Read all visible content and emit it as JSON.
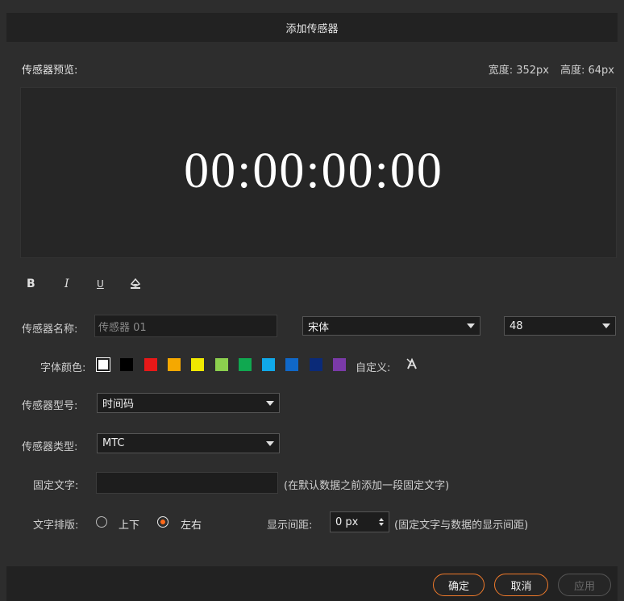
{
  "dialog": {
    "title": "添加传感器"
  },
  "preview": {
    "label": "传感器预览:",
    "width_text": "宽度: 352px",
    "height_text": "高度: 64px",
    "display_text": "00:00:00:00"
  },
  "format_toolbar": {
    "bold": "B",
    "italic": "I",
    "underline": "U",
    "fill": "◬"
  },
  "name_row": {
    "label": "传感器名称:",
    "placeholder": "传感器 01",
    "font_value": "宋体",
    "size_value": "48"
  },
  "color_row": {
    "label": "字体颜色:",
    "swatches": [
      "#ffffff",
      "#000000",
      "#e81818",
      "#f5a800",
      "#f0e800",
      "#8ccf4e",
      "#10a850",
      "#10a8e8",
      "#1068c8",
      "#0a2a78",
      "#7a3aa8"
    ],
    "custom_label": "自定义:",
    "custom_icon": "palette-icon"
  },
  "model_row": {
    "label": "传感器型号:",
    "value": "时间码"
  },
  "type_row": {
    "label": "传感器类型:",
    "value": "MTC"
  },
  "fixed_text_row": {
    "label": "固定文字:",
    "value": "",
    "hint": "(在默认数据之前添加一段固定文字)"
  },
  "layout_row": {
    "label": "文字排版:",
    "options": [
      "上下",
      "左右"
    ],
    "selected": "左右",
    "spacing_label": "显示间距:",
    "spacing_value": "0 px",
    "spacing_hint": "(固定文字与数据的显示间距)"
  },
  "buttons": {
    "ok": "确定",
    "cancel": "取消",
    "apply": "应用"
  },
  "colors": {
    "accent": "#f07a2a",
    "radio_dot": "#ff6a1a"
  }
}
